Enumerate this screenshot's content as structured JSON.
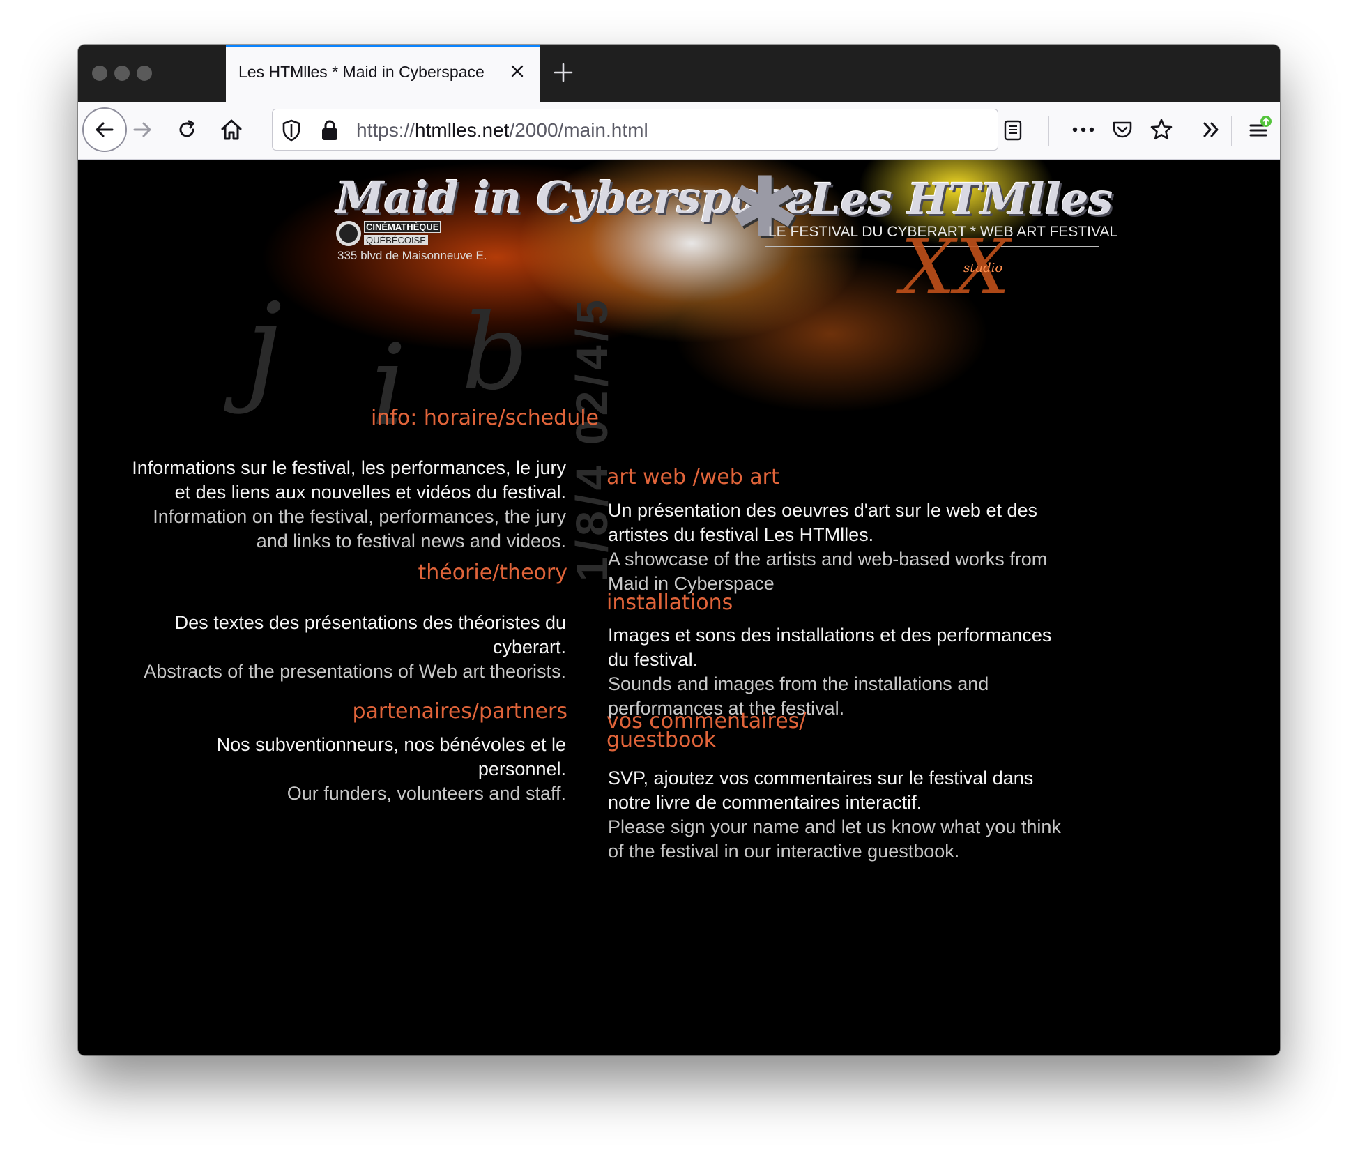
{
  "browser": {
    "tab_title": "Les HTMlles * Maid in Cyberspace",
    "url_scheme": "https://",
    "url_host": "htmlles.net",
    "url_path": "/2000/main.html"
  },
  "banner": {
    "logo_left": "Maid in Cyberspace",
    "logo_right": "Les HTMlles",
    "cine_line1": "CINÉMATHÈQUE",
    "cine_line2": "QUÉBÉCOISE",
    "address": "335 blvd de Maisonneuve E.",
    "tagline": "LE FESTIVAL DU CYBERART * WEB ART FESTIVAL",
    "studio": "studio",
    "vertical_date": "1/8/4 02/4/5"
  },
  "sections": {
    "info": {
      "title": "info: horaire/schedule",
      "fr": "Informations sur le festival, les performances, le jury et des liens aux nouvelles et vidéos du festival.",
      "en": "Information on the festival, performances, the jury and links to festival news and videos."
    },
    "theory": {
      "title": "théorie/theory",
      "fr": "Des textes des présentations des théoristes du cyberart.",
      "en": "Abstracts of the presentations of Web art theorists."
    },
    "partners": {
      "title": "partenaires/partners",
      "fr": "Nos subventionneurs, nos bénévoles et le personnel.",
      "en": "Our funders, volunteers and staff."
    },
    "webart": {
      "title": "art web /web art",
      "fr": "Un présentation des oeuvres d'art sur le web et des artistes du festival Les HTMlles.",
      "en": "A showcase of the artists and web-based works from Maid in Cyberspace"
    },
    "installations": {
      "title": "installations",
      "fr": "Images et sons des installations et des performances du festival.",
      "en": "Sounds and images from the installations and performances at the festival."
    },
    "guestbook": {
      "title1": "vos commentaires/",
      "title2": "guestbook",
      "fr": "SVP, ajoutez vos commentaires sur le festival dans notre livre de commentaires interactif.",
      "en": "Please sign your name and let us know what you think of the festival in our interactive guestbook."
    }
  }
}
